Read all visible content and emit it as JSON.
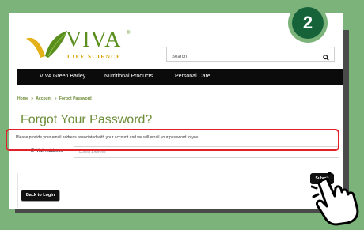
{
  "step": {
    "number": "2"
  },
  "logo": {
    "brand": "VIVA",
    "registered": "®",
    "tagline": "LIFE SCIENCE"
  },
  "search": {
    "placeholder": "Search",
    "icon": "search-icon"
  },
  "nav": {
    "items": [
      "VIVA Green Barley",
      "Nutritional Products",
      "Personal Care"
    ]
  },
  "breadcrumb": {
    "home": "Home",
    "account": "Account",
    "current": "Forgot Password",
    "separator": "»"
  },
  "page": {
    "title": "Forgot Your Password?",
    "description": "Please provide your email address associated with your account and we will email your password to you."
  },
  "form": {
    "email_label": "E-Mail Address",
    "email_placeholder": "E-Mail Address",
    "submit_label": "Submit",
    "back_label": "Back to Login"
  },
  "colors": {
    "background": "#7bb37a",
    "badge": "#16633a",
    "brand_green": "#6e8d39",
    "highlight": "#e0202a",
    "nav": "#0b0b0b"
  }
}
